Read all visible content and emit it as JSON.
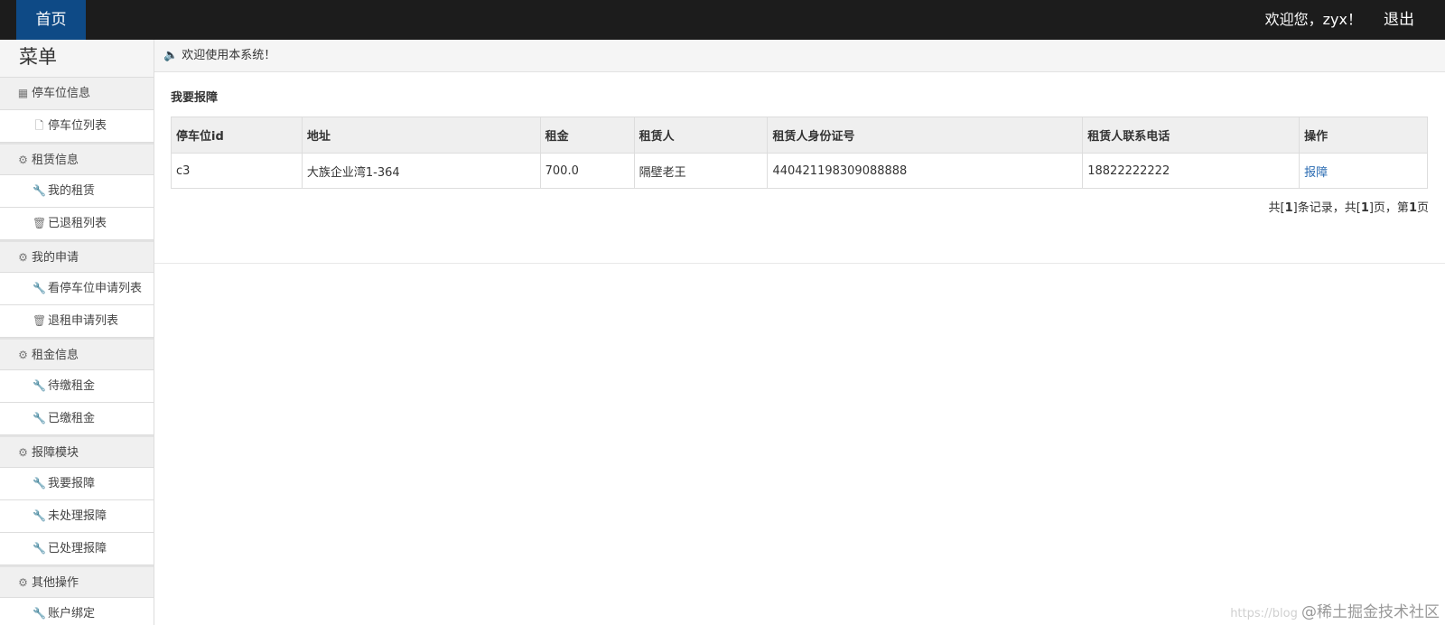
{
  "topbar": {
    "home": "首页",
    "greeting": "欢迎您，zyx！",
    "logout": "退出"
  },
  "sidebar": {
    "title": "菜单",
    "groups": [
      {
        "label": "停车位信息",
        "icon": "user-card-icon",
        "items": [
          {
            "label": "停车位列表",
            "icon": "file-icon"
          }
        ]
      },
      {
        "label": "租赁信息",
        "icon": "gear-icon",
        "items": [
          {
            "label": "我的租赁",
            "icon": "wrench-icon"
          },
          {
            "label": "已退租列表",
            "icon": "trash-icon"
          }
        ]
      },
      {
        "label": "我的申请",
        "icon": "gear-icon",
        "items": [
          {
            "label": "看停车位申请列表",
            "icon": "wrench-icon"
          },
          {
            "label": "退租申请列表",
            "icon": "trash-icon"
          }
        ]
      },
      {
        "label": "租金信息",
        "icon": "gear-icon",
        "items": [
          {
            "label": "待缴租金",
            "icon": "wrench-icon"
          },
          {
            "label": "已缴租金",
            "icon": "wrench-icon"
          }
        ]
      },
      {
        "label": "报障模块",
        "icon": "gear-icon",
        "items": [
          {
            "label": "我要报障",
            "icon": "wrench-icon"
          },
          {
            "label": "未处理报障",
            "icon": "wrench-icon"
          },
          {
            "label": "已处理报障",
            "icon": "wrench-icon"
          }
        ]
      },
      {
        "label": "其他操作",
        "icon": "gear-icon",
        "items": [
          {
            "label": "账户绑定",
            "icon": "wrench-icon"
          }
        ]
      }
    ]
  },
  "main": {
    "welcome": "欢迎使用本系统！",
    "section_title": "我要报障",
    "table": {
      "headers": [
        "停车位id",
        "地址",
        "租金",
        "租赁人",
        "租赁人身份证号",
        "租赁人联系电话",
        "操作"
      ],
      "rows": [
        [
          "c3",
          "大族企业湾1-364",
          "700.0",
          "隔壁老王",
          "440421198309088888",
          "18822222222",
          "报障"
        ]
      ]
    },
    "pager": {
      "t1": "共[",
      "total": "1",
      "t2": "]条记录，共[",
      "pages": "1",
      "t3": "]页，第",
      "current": "1",
      "t4": "页"
    }
  },
  "watermark": {
    "url": "https://blog",
    "brand": "@稀土掘金技术社区"
  },
  "colors": {
    "topbar": "#1c1c1c",
    "home_active": "#0e4a86",
    "link": "#2a6bb2"
  }
}
